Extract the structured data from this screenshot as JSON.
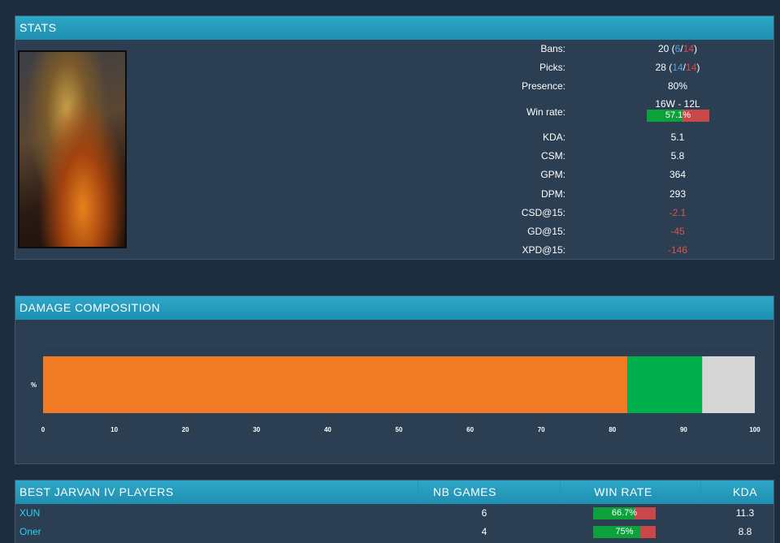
{
  "stats": {
    "title": "STATS",
    "rows": [
      {
        "label": "Bans:",
        "value": "20",
        "blue": "6",
        "red": "14"
      },
      {
        "label": "Picks:",
        "value": "28",
        "blue": "14",
        "red": "14"
      },
      {
        "label": "Presence:",
        "value": "80%"
      },
      {
        "label": "Win rate:",
        "record": "16W - 12L",
        "pct": "57.1%",
        "fraction": 0.571
      },
      {
        "label": "KDA:",
        "value": "5.1"
      },
      {
        "label": "CSM:",
        "value": "5.8"
      },
      {
        "label": "GPM:",
        "value": "364"
      },
      {
        "label": "DPM:",
        "value": "293"
      },
      {
        "label": "CSD@15:",
        "value": "-2.1"
      },
      {
        "label": "GD@15:",
        "value": "-45"
      },
      {
        "label": "XPD@15:",
        "value": "-146"
      }
    ]
  },
  "damage": {
    "title": "DAMAGE COMPOSITION"
  },
  "chart_data": {
    "type": "bar",
    "orientation": "horizontal",
    "stacked": true,
    "categories": [
      "%"
    ],
    "series": [
      {
        "values": [
          82.1
        ],
        "color": "#f07b24"
      },
      {
        "values": [
          10.5
        ],
        "color": "#00b04f"
      },
      {
        "values": [
          7.4
        ],
        "color": "#d6d6d6"
      }
    ],
    "xlim": [
      0,
      100
    ],
    "xticks": [
      "0",
      "10",
      "20",
      "30",
      "40",
      "50",
      "60",
      "70",
      "80",
      "90",
      "100"
    ],
    "ylabel": "%",
    "grid": false
  },
  "players": {
    "title": "BEST JARVAN IV PLAYERS",
    "col_games": "NB GAMES",
    "col_winrate": "WIN RATE",
    "col_kda": "KDA",
    "rows": [
      {
        "name": "XUN",
        "games": "6",
        "winrate": "66.7%",
        "fraction": 0.667,
        "kda": "11.3"
      },
      {
        "name": "Oner",
        "games": "4",
        "winrate": "75%",
        "fraction": 0.75,
        "kda": "8.8"
      }
    ]
  }
}
